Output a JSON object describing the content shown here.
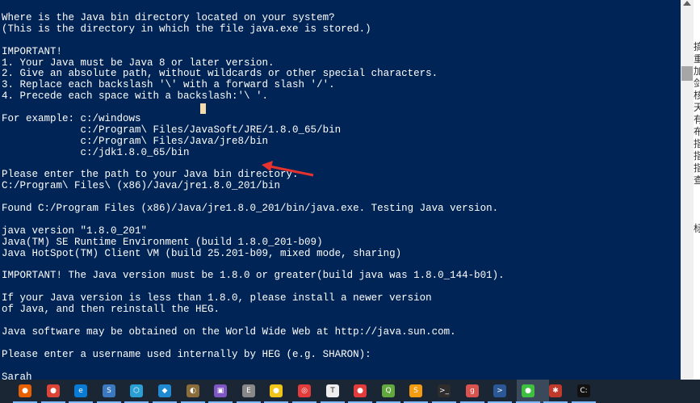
{
  "console": {
    "lines": [
      "Where is the Java bin directory located on your system?",
      "(This is the directory in which the file java.exe is stored.)",
      "",
      "IMPORTANT!",
      "1. Your Java must be Java 8 or later version.",
      "2. Give an absolute path, without wildcards or other special characters.",
      "3. Replace each backslash '\\' with a forward slash '/'.",
      "4. Precede each space with a backslash:'\\ '.",
      "",
      "For example: c:/windows",
      "             c:/Program\\ Files/JavaSoft/JRE/1.8.0_65/bin",
      "             c:/Program\\ Files/Java/jre8/bin",
      "             c:/jdk1.8.0_65/bin",
      "",
      "Please enter the path to your Java bin directory:",
      "C:/Program\\ Files\\ (x86)/Java/jre1.8.0_201/bin",
      "",
      "Found C:/Program Files (x86)/Java/jre1.8.0_201/bin/java.exe. Testing Java version.",
      "",
      "java version \"1.8.0_201\"",
      "Java(TM) SE Runtime Environment (build 1.8.0_201-b09)",
      "Java HotSpot(TM) Client VM (build 25.201-b09, mixed mode, sharing)",
      "",
      "IMPORTANT! The Java version must be 1.8.0 or greater(build java was 1.8.0_144-b01).",
      "",
      "If your Java version is less than 1.8.0, please install a newer version",
      "of Java, and then reinstall the HEG.",
      "",
      "Java software may be obtained on the World Wide Web at http://java.sun.com.",
      "",
      "Please enter a username used internally by HEG (e.g. SHARON):",
      "",
      "Sarah"
    ]
  },
  "side_strip": {
    "chars": [
      "搞",
      "重",
      "加",
      "剑",
      "核",
      "天",
      "有",
      "布",
      "指",
      "指",
      "指",
      "查",
      "",
      "",
      "",
      "标"
    ]
  },
  "taskbar": {
    "icons": [
      {
        "name": "firefox-icon",
        "color": "#e66000",
        "glyph": "●"
      },
      {
        "name": "chrome-icon",
        "color": "#db4437",
        "glyph": "●"
      },
      {
        "name": "edge-icon",
        "color": "#0a7bd4",
        "glyph": "e"
      },
      {
        "name": "app-box-icon",
        "color": "#3a78c2",
        "glyph": "S"
      },
      {
        "name": "hex-app-icon",
        "color": "#2a9fd6",
        "glyph": "⬡"
      },
      {
        "name": "vscode-icon",
        "color": "#1f8ad2",
        "glyph": "◆"
      },
      {
        "name": "qgis-like-icon",
        "color": "#8a6d3b",
        "glyph": "◐"
      },
      {
        "name": "purple-app-icon",
        "color": "#7e57c2",
        "glyph": "▣"
      },
      {
        "name": "elephant-icon",
        "color": "#888888",
        "glyph": "E"
      },
      {
        "name": "yellow-app-icon",
        "color": "#f0c419",
        "glyph": "●"
      },
      {
        "name": "netease-music-icon",
        "color": "#e23b3b",
        "glyph": "◎"
      },
      {
        "name": "typora-icon",
        "color": "#eeeeee",
        "glyph": "T"
      },
      {
        "name": "red-app-icon",
        "color": "#e23b3b",
        "glyph": "●"
      },
      {
        "name": "qgis-icon",
        "color": "#63a83e",
        "glyph": "Q"
      },
      {
        "name": "sublime-icon",
        "color": "#f39c12",
        "glyph": "S"
      },
      {
        "name": "terminal-icon",
        "color": "#2d2d2d",
        "glyph": ">_"
      },
      {
        "name": "red-square-icon",
        "color": "#d9534f",
        "glyph": "g"
      },
      {
        "name": "powershell-icon",
        "color": "#2b5797",
        "glyph": ">"
      },
      {
        "name": "wechat-icon",
        "color": "#3fbf3f",
        "glyph": "●"
      },
      {
        "name": "bug-icon",
        "color": "#c0392b",
        "glyph": "✱"
      },
      {
        "name": "cmd-icon",
        "color": "#111111",
        "glyph": "C:"
      }
    ]
  }
}
